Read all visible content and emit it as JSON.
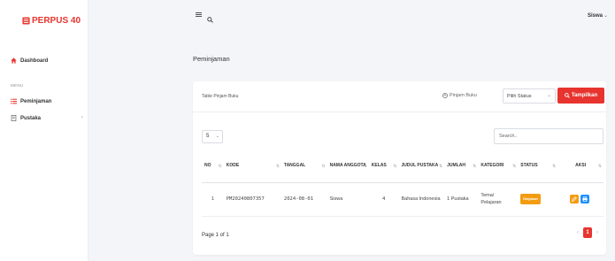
{
  "brand": {
    "name": "PERPUS 40",
    "color": "#e7342e"
  },
  "sidebar": {
    "dashboard": "Dashboard",
    "menu_label": "MENU",
    "items": [
      {
        "label": "Peminjaman",
        "icon": "list-icon"
      },
      {
        "label": "Pustaka",
        "icon": "book-icon"
      }
    ]
  },
  "topbar": {
    "user": "Siswa"
  },
  "page": {
    "title": "Peminjaman"
  },
  "card": {
    "title": "Table Pinjam Buku",
    "pinjam_button": "Pinjam Buku",
    "status_select": "Pilih Status",
    "tampil_button": "Tampilkan",
    "entries_value": "5",
    "search_placeholder": "Search.."
  },
  "table": {
    "headers": [
      "NO",
      "KODE",
      "TANGGAL",
      "NAMA ANGGOTA",
      "KELAS",
      "JUDUL PUSTAKA",
      "JUMLAH",
      "KATEGORI",
      "STATUS",
      "AKSI"
    ],
    "rows": [
      {
        "no": "1",
        "kode": "PM20240807357",
        "tanggal": "2024-08-01",
        "nama": "Siswa",
        "kelas": "4",
        "judul": "Bahasa Indonesia",
        "jumlah": "1 Pustaka",
        "kategori": "Tema/ Pelajaran",
        "status": "Diajukan"
      }
    ]
  },
  "pagination": {
    "info": "Page 1 of 1",
    "current": "1"
  },
  "colors": {
    "accent": "#e7342e",
    "warning": "#f39c12",
    "info": "#1e90ff"
  }
}
